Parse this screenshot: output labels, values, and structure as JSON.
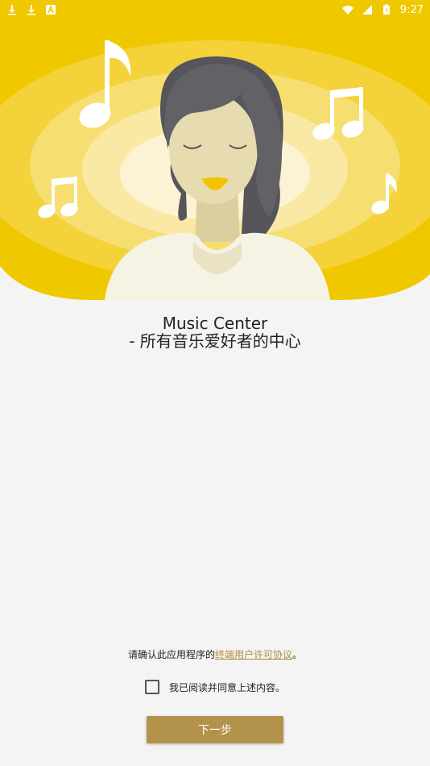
{
  "status_bar": {
    "time": "9:27",
    "left_icons": [
      "download-icon",
      "download-icon",
      "app-notification-icon"
    ],
    "right_icons": [
      "wifi-icon",
      "signal-icon",
      "battery-icon"
    ]
  },
  "hero": {
    "illustration": "woman-listening-music-illustration",
    "colors": {
      "ring_outer": "#f0c800",
      "ring_2": "#f3d23a",
      "ring_3": "#f6de70",
      "ring_4": "#f9e9a4",
      "ring_inner": "#fcf3d4",
      "hair": "#626266",
      "skin": "#e6dcb0",
      "body": "#f6f3e4",
      "lips": "#f2c300"
    }
  },
  "app": {
    "name": "Music Center",
    "tagline": "- 所有音乐爱好者的中心"
  },
  "eula": {
    "prefix": "请确认此应用程序的",
    "link_text": "终端用户许可协议",
    "suffix": "。"
  },
  "agreement": {
    "label": "我已阅读并同意上述内容。",
    "checked": false
  },
  "buttons": {
    "next_label": "下一步"
  },
  "theme": {
    "accent": "#b3924b",
    "link": "#b08a3c",
    "background": "#f4f4f4"
  }
}
